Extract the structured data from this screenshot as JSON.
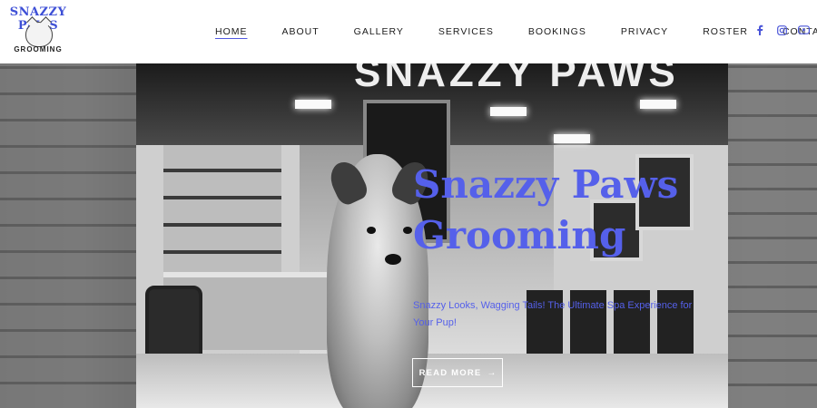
{
  "logo": {
    "top_text": "SNAZZY PAWS",
    "bottom_text": "GROOMING"
  },
  "nav": {
    "items": [
      {
        "label": "HOME",
        "active": true
      },
      {
        "label": "ABOUT"
      },
      {
        "label": "GALLERY"
      },
      {
        "label": "SERVICES"
      },
      {
        "label": "BOOKINGS"
      },
      {
        "label": "PRIVACY"
      },
      {
        "label": "ROSTER"
      },
      {
        "label": "CONTACT"
      }
    ]
  },
  "social": [
    "facebook-icon",
    "instagram-icon",
    "youtube-icon"
  ],
  "hero": {
    "sign": "SNAZZY PAWS",
    "title": "Snazzy Paws Grooming",
    "subtitle": "Snazzy Looks, Wagging Tails! The Ultimate Spa Experience for Your Pup!",
    "cta_label": "READ MORE",
    "cta_arrow": "→"
  },
  "colors": {
    "accent": "#5560ea",
    "nav_text": "#1b1b1b"
  }
}
